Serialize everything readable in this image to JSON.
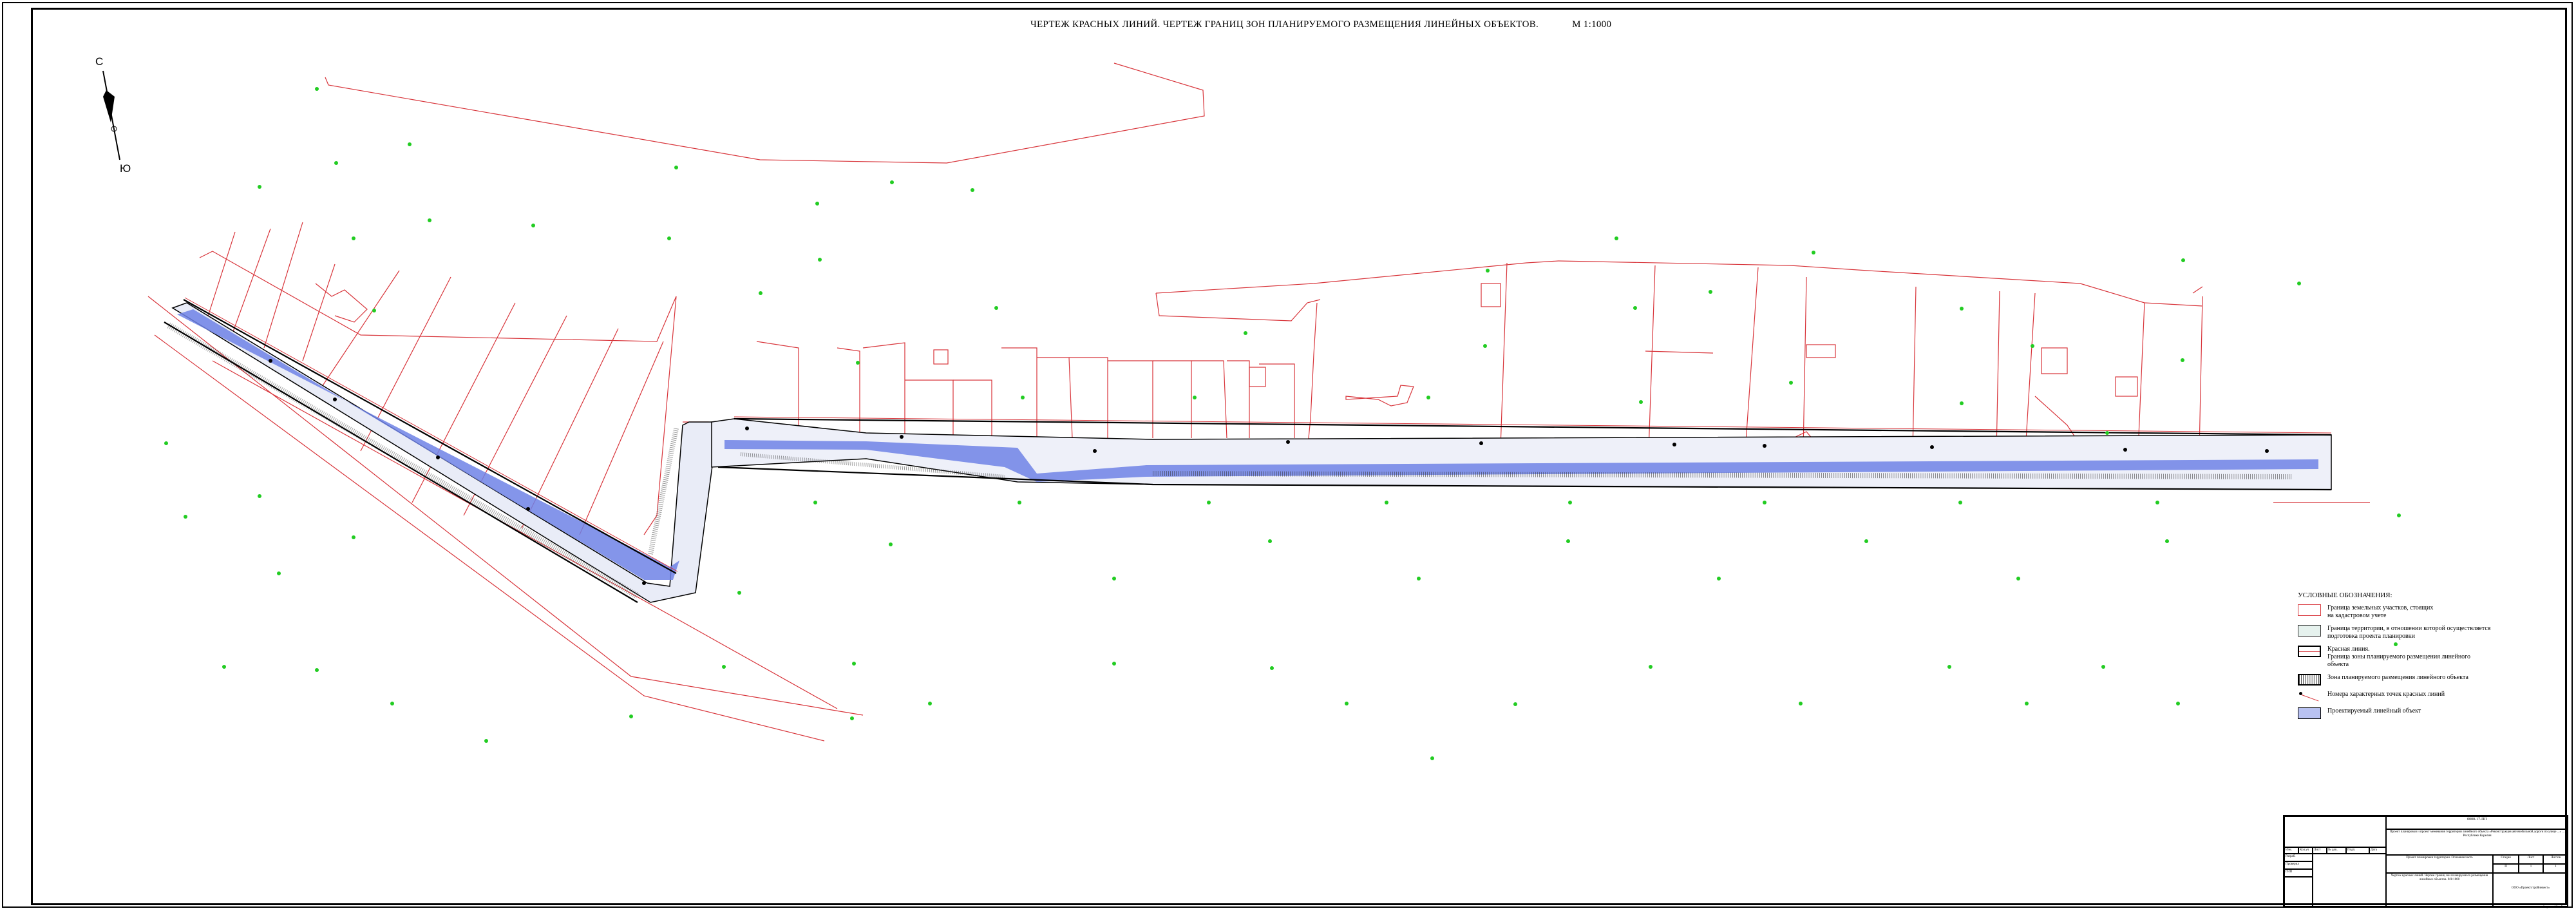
{
  "title": {
    "text": "ЧЕРТЕЖ КРАСНЫХ ЛИНИЙ. ЧЕРТЕЖ ГРАНИЦ ЗОН ПЛАНИРУЕМОГО РАЗМЕЩЕНИЯ ЛИНЕЙНЫХ ОБЪЕКТОВ.",
    "scale": "М 1:1000"
  },
  "north_arrow": {
    "north": "С",
    "south": "Ю"
  },
  "colors": {
    "parcel": "#d8343a",
    "road_fill": "#6f82e6",
    "survey_point": "#22cc22",
    "zone": "#555555"
  },
  "legend": {
    "title": "УСЛОВНЫЕ ОБОЗНАЧЕНИЯ:",
    "items": [
      {
        "symbol": "parcel-boundary",
        "text": "Граница земельных участков, стоящих\nна кадастровом учете"
      },
      {
        "symbol": "territory-boundary",
        "text": "Граница территории, в отношении которой осуществляется\nподготовка проекта планировки"
      },
      {
        "symbol": "red-line",
        "text": "Красная линия.\nГраница зоны планируемого размещения линейного объекта"
      },
      {
        "symbol": "placement-zone",
        "text": "Зона планируемого размещения линейного объекта"
      },
      {
        "symbol": "characteristic-point",
        "text": "Номера характерных точек красных линий"
      },
      {
        "symbol": "designed-object",
        "text": "Проектируемый линейный объект"
      }
    ]
  },
  "stamp": {
    "code": "0000-17-ПП",
    "project": "Проект планировки и проект межевания территории линейного объекта «Реконструкция автомобильной дороги по улице ...» ... Республики Карелия",
    "section": "Проект планировки территории. Основная часть",
    "sheet_title": "Чертеж красных линий. Чертеж границ зон планируемого размещения линейных объектов. М1:1000",
    "org": "ООО «Проектстройинвест»",
    "stage_label": "Стадия",
    "sheet_label": "Лист",
    "sheets_label": "Листов",
    "stage": "П",
    "sheet": "1",
    "sheets": "1",
    "role_rows": [
      "Изм.",
      "Кол.уч",
      "Лист",
      "№ док.",
      "Подп.",
      "Дата"
    ],
    "people": [
      "Разраб.",
      "Проверил",
      "ГИП"
    ],
    "format": "Формат А3 x 5"
  }
}
